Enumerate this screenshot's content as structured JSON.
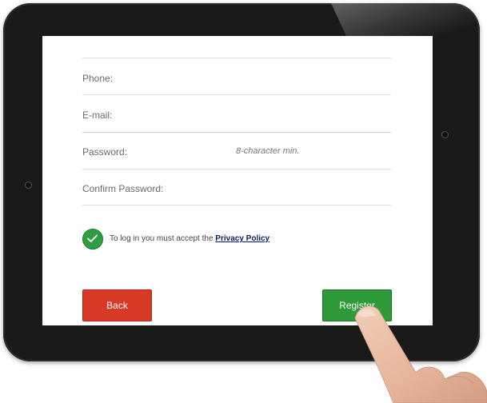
{
  "form": {
    "phone_label": "Phone:",
    "email_label": "E-mail:",
    "password_label": "Password:",
    "password_hint": "8-character min.",
    "confirm_label": "Confirm Password:"
  },
  "consent": {
    "checked": true,
    "text": "To log in you must accept the ",
    "link": "Privacy Policy"
  },
  "buttons": {
    "back": "Back",
    "register": "Register"
  },
  "colors": {
    "back": "#d93a25",
    "register": "#2e9a3a",
    "check": "#2e9e43",
    "link": "#0b1e6b"
  },
  "icons": [
    "check-icon",
    "finger-pointer"
  ]
}
